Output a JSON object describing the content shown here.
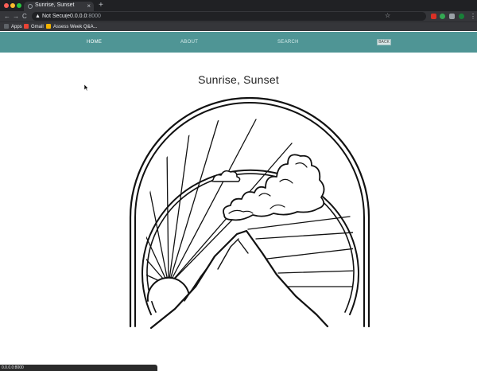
{
  "browser": {
    "tab_title": "Sunrise, Sunset",
    "tab_close": "×",
    "new_tab": "+",
    "back": "←",
    "forward": "→",
    "reload": "C",
    "security_warning_icon": "▲",
    "security_text": "Not Secure",
    "url_host": "0.0.0.0",
    "url_port": ":8000",
    "bookmark_star": "☆",
    "bookmarks": [
      {
        "label": "Apps",
        "color": "#5f6368"
      },
      {
        "label": "Gmail",
        "color": "#ea4335"
      },
      {
        "label": "Assess Week Q&A...",
        "color": "#f4b400"
      }
    ],
    "status_text": "0.0.0.0:8000",
    "window_dots": [
      "#ff5f57",
      "#febc2e",
      "#28c840"
    ],
    "extension_colors": [
      "#d93025",
      "#34a853",
      "#9aa0a6",
      "#188038"
    ]
  },
  "nav": {
    "home": "HOME",
    "about": "ABOUT",
    "search": "SEARCH",
    "back": "BACK",
    "background_color": "#4f9595"
  },
  "page": {
    "title": "Sunrise, Sunset"
  },
  "illustration": {
    "subject": "line-art sunrise over mountain inside double arch"
  }
}
